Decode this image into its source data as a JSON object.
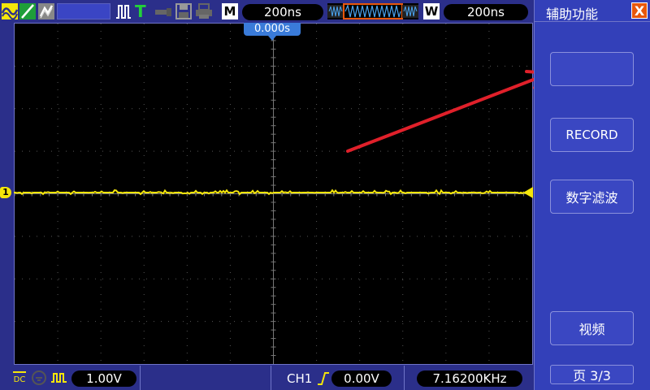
{
  "toolbar": {
    "memory_depth_badge": "M",
    "timebase": "200ns",
    "window_badge": "W",
    "window_timebase": "200ns"
  },
  "screen": {
    "trigger_position": "0.000s",
    "channel_marker": "1",
    "trace_color": "#f5e60a"
  },
  "bottom": {
    "coupling": "DC",
    "volts_per_div": "1.00V",
    "trigger_source": "CH1",
    "trigger_level": "0.00V",
    "frequency": "7.16200KHz"
  },
  "menu": {
    "title": "辅助功能",
    "close_label": "X",
    "items": [
      {
        "label": ""
      },
      {
        "label": "RECORD"
      },
      {
        "label": "数字滤波"
      },
      {
        "label": "视频"
      }
    ],
    "page_label": "页 3/3"
  },
  "annotation": {
    "arrow_color": "#e0202a"
  },
  "icons": [
    "wave-mode-icon",
    "vector-mode-icon",
    "persistence-icon",
    "run-stop-icon",
    "trigger-icon",
    "usb-icon",
    "save-icon",
    "print-icon",
    "wave-preview-icon",
    "ground-coupling-icon",
    "bandwidth-icon",
    "trigger-edge-icon"
  ]
}
